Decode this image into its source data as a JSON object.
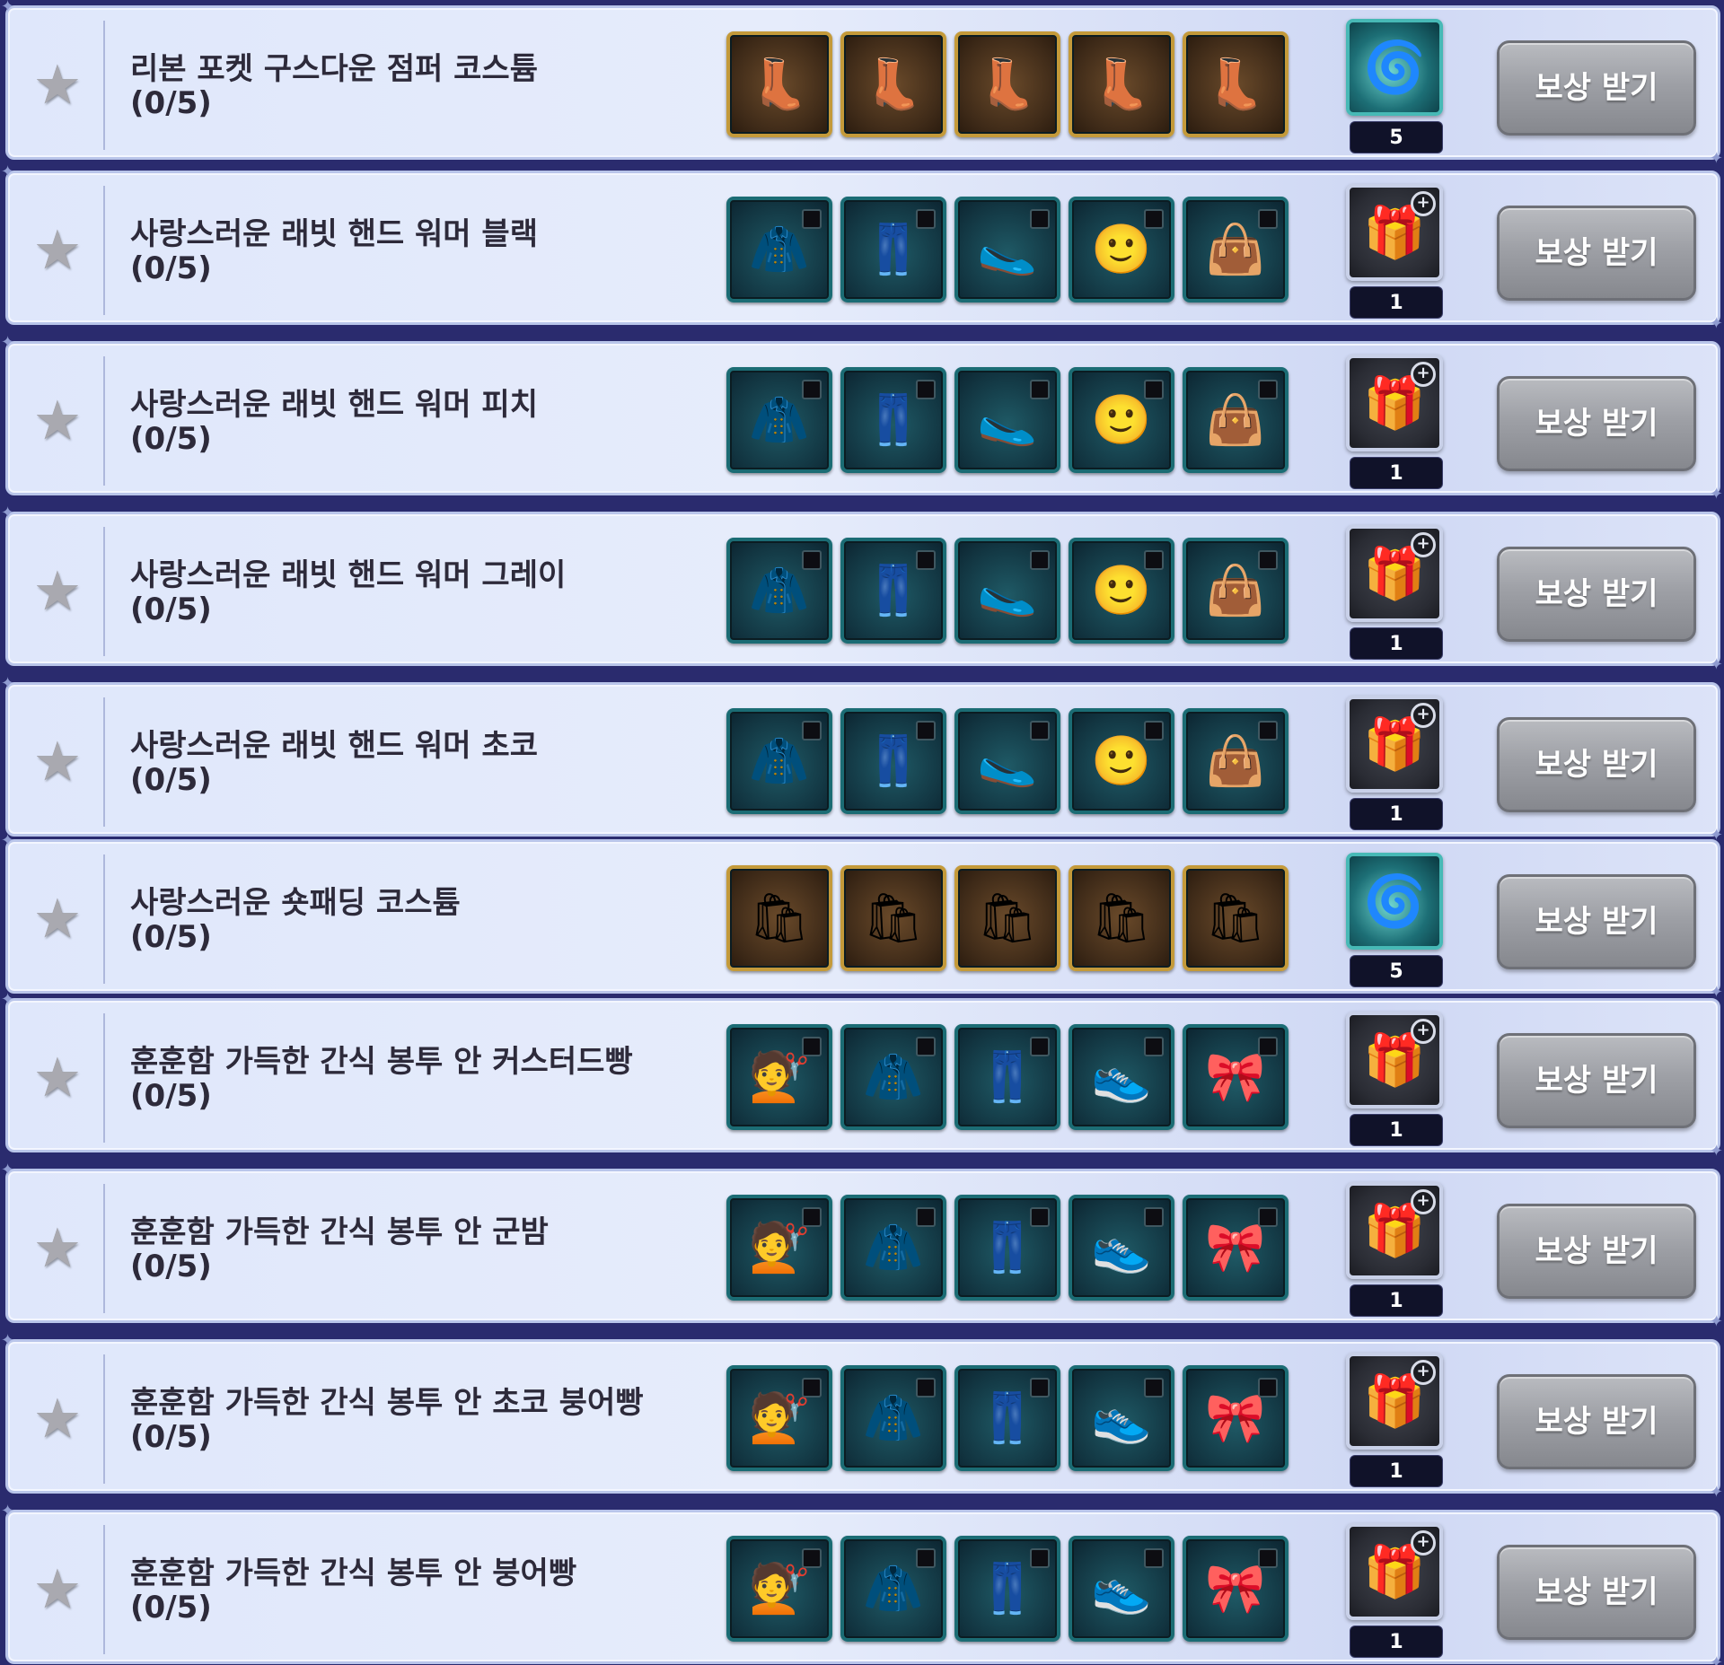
{
  "claim_label": "보상 받기",
  "rows": [
    {
      "title": "리본 포켓 구스다운 점퍼 코스튬",
      "progress": "(0/5)",
      "item_style": "gold",
      "items": [
        {
          "icon": "fur-boots-icon"
        },
        {
          "icon": "fur-boots-icon"
        },
        {
          "icon": "fur-boots-icon"
        },
        {
          "icon": "fur-boots-icon"
        },
        {
          "icon": "fur-boots-icon"
        }
      ],
      "reward": {
        "icon": "costume-orb-icon",
        "style": "orb",
        "count": "5"
      }
    },
    {
      "title": "사랑스러운 래빗 핸드 워머 블랙",
      "progress": "(0/5)",
      "item_style": "teal",
      "items": [
        {
          "icon": "jacket-icon"
        },
        {
          "icon": "pants-icon"
        },
        {
          "icon": "slippers-icon"
        },
        {
          "icon": "face-icon"
        },
        {
          "icon": "handbag-icon"
        }
      ],
      "reward": {
        "icon": "gift-box-icon",
        "style": "box",
        "count": "1"
      }
    },
    {
      "title": "사랑스러운 래빗 핸드 워머 피치",
      "progress": "(0/5)",
      "item_style": "teal",
      "items": [
        {
          "icon": "jacket-icon"
        },
        {
          "icon": "pants-icon"
        },
        {
          "icon": "slippers-icon"
        },
        {
          "icon": "face-icon"
        },
        {
          "icon": "handbag-icon"
        }
      ],
      "reward": {
        "icon": "gift-box-icon",
        "style": "box",
        "count": "1"
      }
    },
    {
      "title": "사랑스러운 래빗 핸드 워머 그레이",
      "progress": "(0/5)",
      "item_style": "teal",
      "items": [
        {
          "icon": "jacket-icon"
        },
        {
          "icon": "pants-icon"
        },
        {
          "icon": "slippers-icon"
        },
        {
          "icon": "face-icon"
        },
        {
          "icon": "handbag-icon"
        }
      ],
      "reward": {
        "icon": "gift-box-icon",
        "style": "box",
        "count": "1"
      }
    },
    {
      "title": "사랑스러운 래빗 핸드 워머 초코",
      "progress": "(0/5)",
      "item_style": "teal",
      "items": [
        {
          "icon": "jacket-icon"
        },
        {
          "icon": "pants-icon"
        },
        {
          "icon": "slippers-icon"
        },
        {
          "icon": "face-icon"
        },
        {
          "icon": "handbag-icon"
        }
      ],
      "reward": {
        "icon": "gift-box-icon",
        "style": "box",
        "count": "1"
      }
    },
    {
      "title": "사랑스러운 숏패딩 코스튬",
      "progress": "(0/5)",
      "item_style": "gold",
      "items": [
        {
          "icon": "snack-bag-icon"
        },
        {
          "icon": "snack-bag-icon"
        },
        {
          "icon": "snack-bag-icon"
        },
        {
          "icon": "snack-bag-icon"
        },
        {
          "icon": "snack-bag-icon"
        }
      ],
      "reward": {
        "icon": "costume-orb-icon",
        "style": "orb",
        "count": "5"
      }
    },
    {
      "title": "훈훈함 가득한 간식 봉투 안 커스터드빵",
      "progress": "(0/5)",
      "item_style": "teal",
      "items": [
        {
          "icon": "hair-icon"
        },
        {
          "icon": "puffer-jacket-icon"
        },
        {
          "icon": "jeans-icon"
        },
        {
          "icon": "shoes-icon"
        },
        {
          "icon": "bow-icon"
        }
      ],
      "reward": {
        "icon": "gift-box-icon",
        "style": "box",
        "count": "1"
      }
    },
    {
      "title": "훈훈함 가득한 간식 봉투 안 군밤",
      "progress": "(0/5)",
      "item_style": "teal",
      "items": [
        {
          "icon": "hair-icon"
        },
        {
          "icon": "puffer-jacket-icon"
        },
        {
          "icon": "jeans-icon"
        },
        {
          "icon": "shoes-icon"
        },
        {
          "icon": "bow-icon"
        }
      ],
      "reward": {
        "icon": "gift-box-icon",
        "style": "box",
        "count": "1"
      }
    },
    {
      "title": "훈훈함 가득한 간식 봉투 안 초코 붕어빵",
      "progress": "(0/5)",
      "item_style": "teal",
      "items": [
        {
          "icon": "hair-icon"
        },
        {
          "icon": "puffer-jacket-icon"
        },
        {
          "icon": "jeans-icon"
        },
        {
          "icon": "shoes-icon"
        },
        {
          "icon": "bow-icon"
        }
      ],
      "reward": {
        "icon": "gift-box-icon",
        "style": "box",
        "count": "1"
      }
    },
    {
      "title": "훈훈함 가득한 간식 봉투 안 붕어빵",
      "progress": "(0/5)",
      "item_style": "teal",
      "items": [
        {
          "icon": "hair-icon"
        },
        {
          "icon": "puffer-jacket-icon"
        },
        {
          "icon": "jeans-icon"
        },
        {
          "icon": "shoes-icon"
        },
        {
          "icon": "bow-icon"
        }
      ],
      "reward": {
        "icon": "gift-box-icon",
        "style": "box",
        "count": "1"
      }
    }
  ]
}
